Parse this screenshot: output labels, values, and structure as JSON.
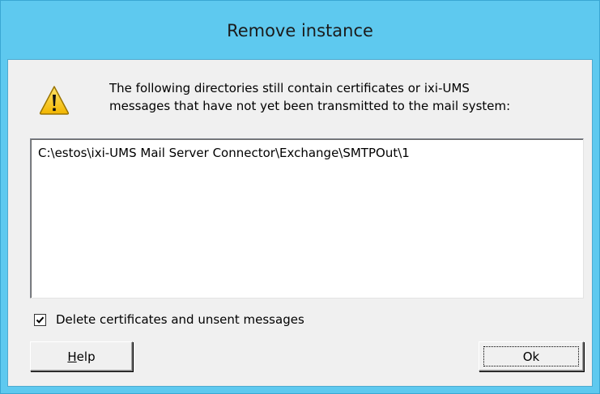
{
  "dialog": {
    "title": "Remove instance",
    "message_line1": "The following directories still contain certificates or ixi-UMS",
    "message_line2": "messages that have not yet been transmitted to the mail system:",
    "icon": "warning-icon",
    "directories": [
      "C:\\estos\\ixi-UMS Mail Server Connector\\Exchange\\SMTPOut\\1"
    ],
    "checkbox_label": "Delete certificates and unsent messages",
    "checkbox_checked": true,
    "help_accel": "H",
    "help_rest": "elp",
    "ok_label": "Ok"
  },
  "colors": {
    "titlebar": "#5ec9ef",
    "client": "#f0f0f0",
    "warning_fill": "#f5c400"
  }
}
